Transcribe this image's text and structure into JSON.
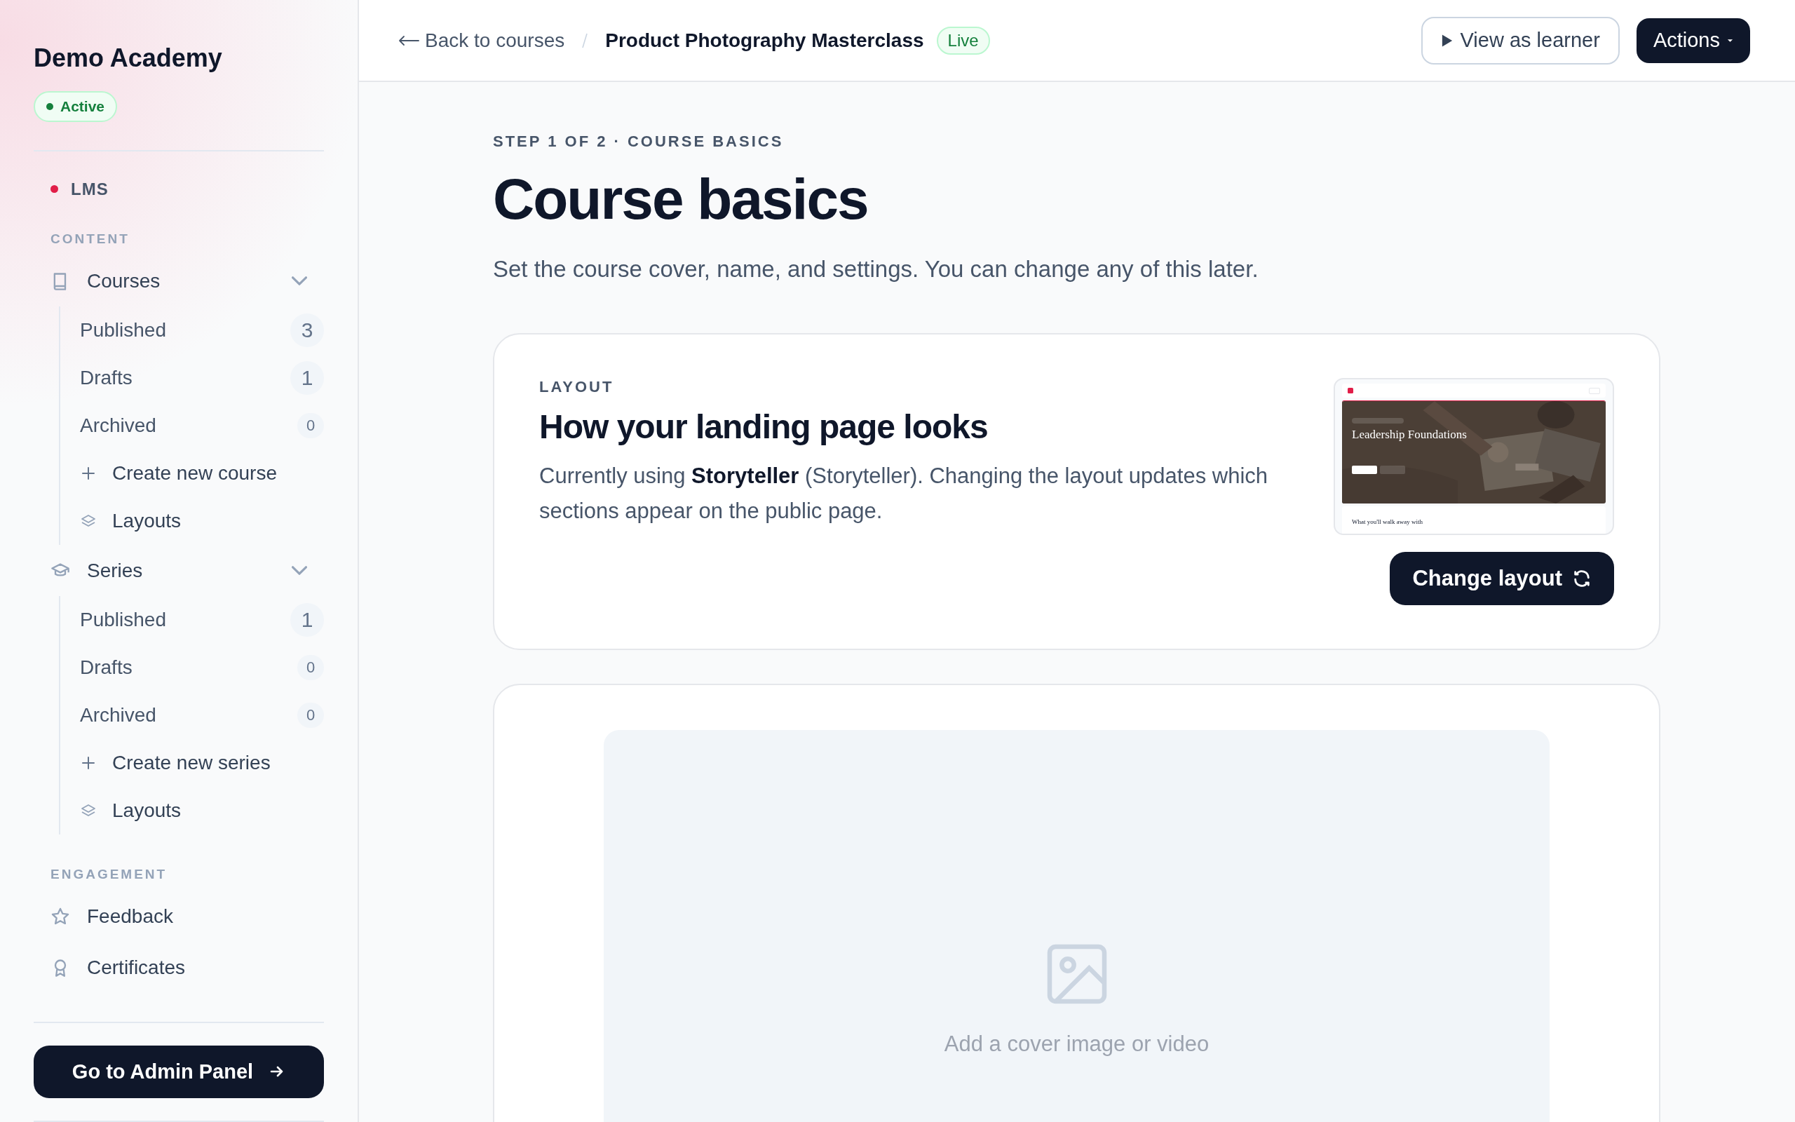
{
  "sidebar": {
    "brand": "Demo Academy",
    "status": {
      "label": "Active",
      "active": true
    },
    "app": {
      "label": "LMS",
      "color": "#e11d48"
    },
    "sections": [
      {
        "heading": "CONTENT",
        "items": [
          {
            "label": "Courses",
            "expanded": true,
            "children": [
              {
                "kind": "filter",
                "label": "Published",
                "count": "3"
              },
              {
                "kind": "filter",
                "label": "Drafts",
                "count": "1"
              },
              {
                "kind": "filter",
                "label": "Archived",
                "count": "0"
              },
              {
                "kind": "create",
                "label": "Create new course"
              },
              {
                "kind": "layouts",
                "label": "Layouts"
              }
            ]
          },
          {
            "label": "Series",
            "expanded": true,
            "children": [
              {
                "kind": "filter",
                "label": "Published",
                "count": "1"
              },
              {
                "kind": "filter",
                "label": "Drafts",
                "count": "0"
              },
              {
                "kind": "filter",
                "label": "Archived",
                "count": "0"
              },
              {
                "kind": "create",
                "label": "Create new series"
              },
              {
                "kind": "layouts",
                "label": "Layouts"
              }
            ]
          }
        ]
      },
      {
        "heading": "ENGAGEMENT",
        "items": [
          {
            "label": "Feedback"
          },
          {
            "label": "Certificates"
          }
        ]
      }
    ],
    "admin_button": "Go to Admin Panel"
  },
  "header": {
    "back": "Back to courses",
    "current": "Product Photography Masterclass",
    "status": "Live",
    "buttons": [
      {
        "kind": "outline",
        "label": "View as learner"
      },
      {
        "kind": "primary",
        "label": "Actions"
      }
    ]
  },
  "main": {
    "step": "STEP 1 OF 2 · COURSE BASICS",
    "title": "Course basics",
    "description": "Set the course cover, name, and settings. You can change any of this later.",
    "layout_card": {
      "label": "LAYOUT",
      "heading": "How your landing page looks",
      "description": "Currently using **Storyteller** (Storyteller). Changing the layout updates which sections appear on the public page.",
      "preview": {
        "title": "Leadership Foundations",
        "section_heading": "What you'll walk away with"
      },
      "button": "Change layout"
    },
    "cover": {
      "placeholder": "Add a cover image or video"
    }
  }
}
